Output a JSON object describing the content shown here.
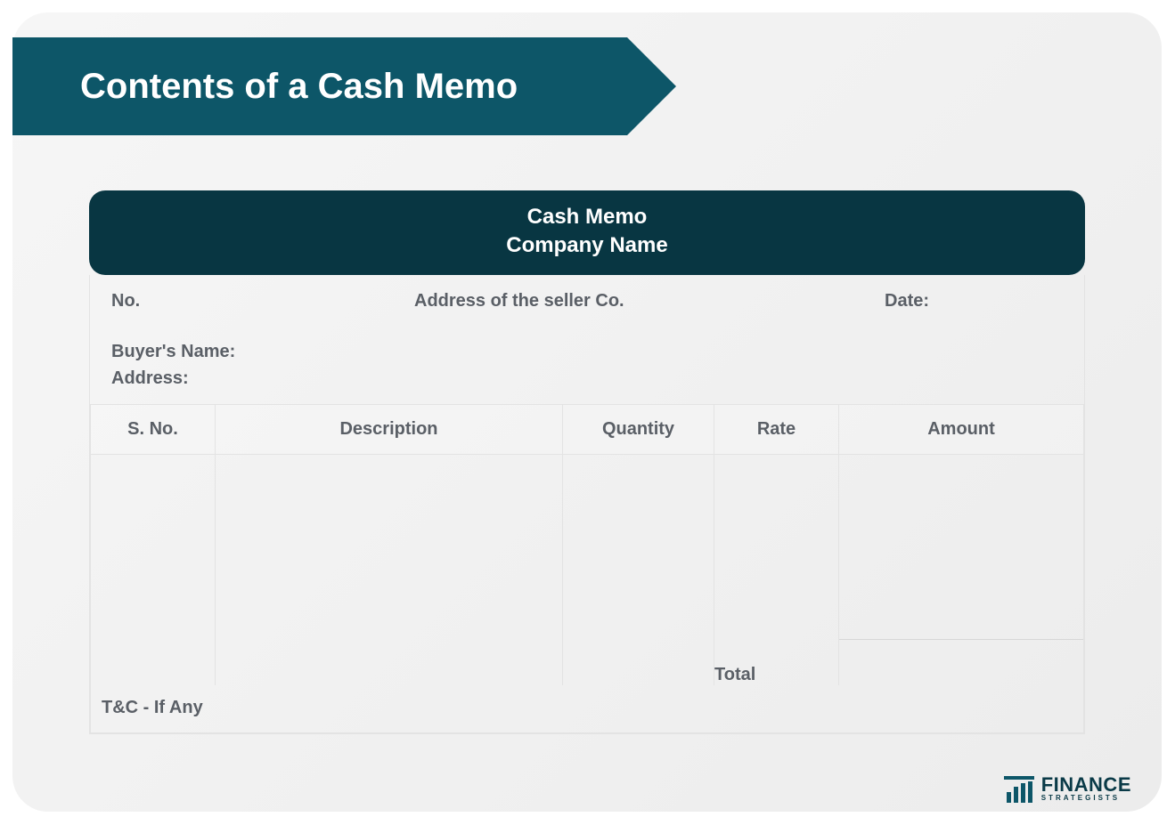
{
  "banner": {
    "title": "Contents of a Cash Memo"
  },
  "memo": {
    "header_line1": "Cash Memo",
    "header_line2": "Company Name",
    "info": {
      "no_label": "No.",
      "seller_address_label": "Address of the seller Co.",
      "date_label": "Date:",
      "buyer_name_label": "Buyer's Name:",
      "buyer_address_label": "Address:"
    },
    "columns": {
      "sno": "S. No.",
      "description": "Description",
      "quantity": "Quantity",
      "rate": "Rate",
      "amount": "Amount"
    },
    "total_label": "Total",
    "tc_label": "T&C - If Any"
  },
  "brand": {
    "name": "FINANCE",
    "sub": "STRATEGISTS"
  }
}
